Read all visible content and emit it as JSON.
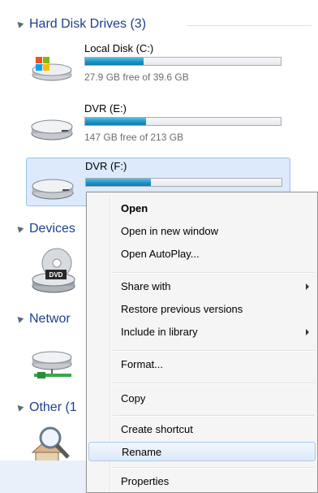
{
  "groups": {
    "hard_disks": "Hard Disk Drives (3)",
    "devices": "Devices",
    "network": "Networ",
    "other": "Other (1"
  },
  "drives": [
    {
      "name": "Local Disk (C:)",
      "free": "27.9 GB free of 39.6 GB",
      "used_fraction": 0.3
    },
    {
      "name": "DVR (E:)",
      "free": "147 GB free of 213 GB",
      "used_fraction": 0.31
    },
    {
      "name": "DVR (F:)",
      "free": "",
      "used_fraction": 0.33
    }
  ],
  "dvd_label": "DVD",
  "menu": {
    "items": [
      {
        "label": "Open"
      },
      {
        "label": "Open in new window"
      },
      {
        "label": "Open AutoPlay..."
      },
      {
        "label": "Share with"
      },
      {
        "label": "Restore previous versions"
      },
      {
        "label": "Include in library"
      },
      {
        "label": "Format..."
      },
      {
        "label": "Copy"
      },
      {
        "label": "Create shortcut"
      },
      {
        "label": "Rename"
      },
      {
        "label": "Properties"
      }
    ]
  },
  "colors": {
    "group_header": "#1e3f8c",
    "bar_fill": "#1c93c7",
    "selection": "#dceafc"
  }
}
